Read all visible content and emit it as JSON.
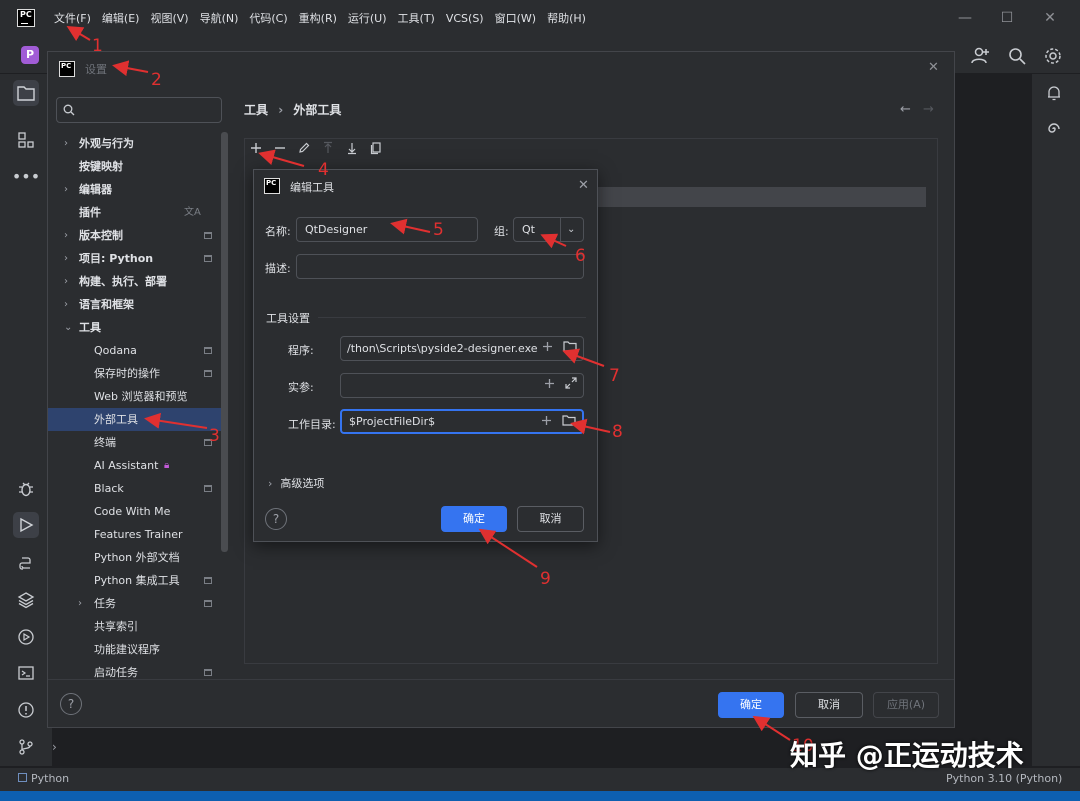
{
  "titlebar": {
    "logo_text": "PC",
    "menu": [
      "文件(F)",
      "编辑(E)",
      "视图(V)",
      "导航(N)",
      "代码(C)",
      "重构(R)",
      "运行(U)",
      "工具(T)",
      "VCS(S)",
      "窗口(W)",
      "帮助(H)"
    ],
    "minimize": "—",
    "maximize": "☐",
    "close": "✕"
  },
  "project_badge": "P",
  "settings": {
    "logo_text": "PC",
    "title": "设置",
    "search_placeholder": "Q-",
    "breadcrumb": [
      "工具",
      "外部工具"
    ],
    "tree": [
      {
        "label": "外观与行为",
        "level": 0,
        "chevron": "›",
        "bold": true
      },
      {
        "label": "按键映射",
        "level": 0,
        "bold": true
      },
      {
        "label": "编辑器",
        "level": 0,
        "chevron": "›",
        "bold": true
      },
      {
        "label": "插件",
        "level": 0,
        "bold": true,
        "mark": "translate"
      },
      {
        "label": "版本控制",
        "level": 0,
        "chevron": "›",
        "bold": true,
        "mark": "box"
      },
      {
        "label": "项目: Python",
        "level": 0,
        "chevron": "›",
        "bold": true,
        "mark": "box"
      },
      {
        "label": "构建、执行、部署",
        "level": 0,
        "chevron": "›",
        "bold": true
      },
      {
        "label": "语言和框架",
        "level": 0,
        "chevron": "›",
        "bold": true
      },
      {
        "label": "工具",
        "level": 0,
        "chevron": "⌄",
        "bold": true
      },
      {
        "label": "Qodana",
        "level": 1,
        "mark": "box"
      },
      {
        "label": "保存时的操作",
        "level": 1,
        "mark": "box"
      },
      {
        "label": "Web 浏览器和预览",
        "level": 1
      },
      {
        "label": "外部工具",
        "level": 1,
        "selected": true
      },
      {
        "label": "终端",
        "level": 1,
        "mark": "box"
      },
      {
        "label": "AI Assistant",
        "level": 1,
        "mark": "lock"
      },
      {
        "label": "Black",
        "level": 1,
        "mark": "box"
      },
      {
        "label": "Code With Me",
        "level": 1
      },
      {
        "label": "Features Trainer",
        "level": 1
      },
      {
        "label": "Python 外部文档",
        "level": 1
      },
      {
        "label": "Python 集成工具",
        "level": 1,
        "mark": "box"
      },
      {
        "label": "任务",
        "level": 1,
        "chevron": "›",
        "mark": "box"
      },
      {
        "label": "共享索引",
        "level": 1
      },
      {
        "label": "功能建议程序",
        "level": 1
      },
      {
        "label": "启动任务",
        "level": 1,
        "mark": "box"
      }
    ],
    "ok": "确定",
    "cancel": "取消",
    "apply": "应用(A)",
    "help": "?"
  },
  "edit_tool": {
    "logo_text": "PC",
    "title": "编辑工具",
    "name_label": "名称:",
    "name_value": "QtDesigner",
    "group_label": "组:",
    "group_value": "Qt",
    "desc_label": "描述:",
    "desc_value": "",
    "section_title": "工具设置",
    "program_label": "程序:",
    "program_value": "/thon\\Scripts\\pyside2-designer.exe",
    "args_label": "实参:",
    "args_value": "",
    "workdir_label": "工作目录:",
    "workdir_value": "$ProjectFileDir$",
    "advanced": "高级选项",
    "ok": "确定",
    "cancel": "取消",
    "help": "?"
  },
  "statusbar": {
    "left": "Python",
    "right": "Python 3.10 (Python)"
  },
  "annotations": [
    "1",
    "2",
    "3",
    "4",
    "5",
    "6",
    "7",
    "8",
    "9",
    "10"
  ],
  "watermark": "知乎 @正运动技术",
  "colors": {
    "accent": "#3574f0",
    "annotation": "#e03030",
    "selection": "#2e436e"
  }
}
